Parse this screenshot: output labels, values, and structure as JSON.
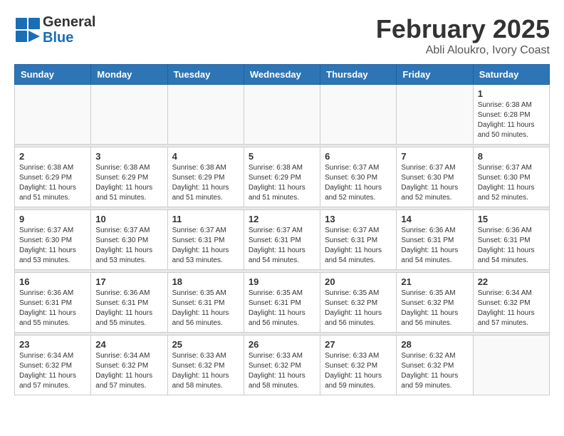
{
  "header": {
    "logo_general": "General",
    "logo_blue": "Blue",
    "month": "February 2025",
    "location": "Abli Aloukro, Ivory Coast"
  },
  "days_of_week": [
    "Sunday",
    "Monday",
    "Tuesday",
    "Wednesday",
    "Thursday",
    "Friday",
    "Saturday"
  ],
  "weeks": [
    [
      {
        "day": "",
        "info": ""
      },
      {
        "day": "",
        "info": ""
      },
      {
        "day": "",
        "info": ""
      },
      {
        "day": "",
        "info": ""
      },
      {
        "day": "",
        "info": ""
      },
      {
        "day": "",
        "info": ""
      },
      {
        "day": "1",
        "info": "Sunrise: 6:38 AM\nSunset: 6:28 PM\nDaylight: 11 hours\nand 50 minutes."
      }
    ],
    [
      {
        "day": "2",
        "info": "Sunrise: 6:38 AM\nSunset: 6:29 PM\nDaylight: 11 hours\nand 51 minutes."
      },
      {
        "day": "3",
        "info": "Sunrise: 6:38 AM\nSunset: 6:29 PM\nDaylight: 11 hours\nand 51 minutes."
      },
      {
        "day": "4",
        "info": "Sunrise: 6:38 AM\nSunset: 6:29 PM\nDaylight: 11 hours\nand 51 minutes."
      },
      {
        "day": "5",
        "info": "Sunrise: 6:38 AM\nSunset: 6:29 PM\nDaylight: 11 hours\nand 51 minutes."
      },
      {
        "day": "6",
        "info": "Sunrise: 6:37 AM\nSunset: 6:30 PM\nDaylight: 11 hours\nand 52 minutes."
      },
      {
        "day": "7",
        "info": "Sunrise: 6:37 AM\nSunset: 6:30 PM\nDaylight: 11 hours\nand 52 minutes."
      },
      {
        "day": "8",
        "info": "Sunrise: 6:37 AM\nSunset: 6:30 PM\nDaylight: 11 hours\nand 52 minutes."
      }
    ],
    [
      {
        "day": "9",
        "info": "Sunrise: 6:37 AM\nSunset: 6:30 PM\nDaylight: 11 hours\nand 53 minutes."
      },
      {
        "day": "10",
        "info": "Sunrise: 6:37 AM\nSunset: 6:30 PM\nDaylight: 11 hours\nand 53 minutes."
      },
      {
        "day": "11",
        "info": "Sunrise: 6:37 AM\nSunset: 6:31 PM\nDaylight: 11 hours\nand 53 minutes."
      },
      {
        "day": "12",
        "info": "Sunrise: 6:37 AM\nSunset: 6:31 PM\nDaylight: 11 hours\nand 54 minutes."
      },
      {
        "day": "13",
        "info": "Sunrise: 6:37 AM\nSunset: 6:31 PM\nDaylight: 11 hours\nand 54 minutes."
      },
      {
        "day": "14",
        "info": "Sunrise: 6:36 AM\nSunset: 6:31 PM\nDaylight: 11 hours\nand 54 minutes."
      },
      {
        "day": "15",
        "info": "Sunrise: 6:36 AM\nSunset: 6:31 PM\nDaylight: 11 hours\nand 54 minutes."
      }
    ],
    [
      {
        "day": "16",
        "info": "Sunrise: 6:36 AM\nSunset: 6:31 PM\nDaylight: 11 hours\nand 55 minutes."
      },
      {
        "day": "17",
        "info": "Sunrise: 6:36 AM\nSunset: 6:31 PM\nDaylight: 11 hours\nand 55 minutes."
      },
      {
        "day": "18",
        "info": "Sunrise: 6:35 AM\nSunset: 6:31 PM\nDaylight: 11 hours\nand 56 minutes."
      },
      {
        "day": "19",
        "info": "Sunrise: 6:35 AM\nSunset: 6:31 PM\nDaylight: 11 hours\nand 56 minutes."
      },
      {
        "day": "20",
        "info": "Sunrise: 6:35 AM\nSunset: 6:32 PM\nDaylight: 11 hours\nand 56 minutes."
      },
      {
        "day": "21",
        "info": "Sunrise: 6:35 AM\nSunset: 6:32 PM\nDaylight: 11 hours\nand 56 minutes."
      },
      {
        "day": "22",
        "info": "Sunrise: 6:34 AM\nSunset: 6:32 PM\nDaylight: 11 hours\nand 57 minutes."
      }
    ],
    [
      {
        "day": "23",
        "info": "Sunrise: 6:34 AM\nSunset: 6:32 PM\nDaylight: 11 hours\nand 57 minutes."
      },
      {
        "day": "24",
        "info": "Sunrise: 6:34 AM\nSunset: 6:32 PM\nDaylight: 11 hours\nand 57 minutes."
      },
      {
        "day": "25",
        "info": "Sunrise: 6:33 AM\nSunset: 6:32 PM\nDaylight: 11 hours\nand 58 minutes."
      },
      {
        "day": "26",
        "info": "Sunrise: 6:33 AM\nSunset: 6:32 PM\nDaylight: 11 hours\nand 58 minutes."
      },
      {
        "day": "27",
        "info": "Sunrise: 6:33 AM\nSunset: 6:32 PM\nDaylight: 11 hours\nand 59 minutes."
      },
      {
        "day": "28",
        "info": "Sunrise: 6:32 AM\nSunset: 6:32 PM\nDaylight: 11 hours\nand 59 minutes."
      },
      {
        "day": "",
        "info": ""
      }
    ]
  ]
}
